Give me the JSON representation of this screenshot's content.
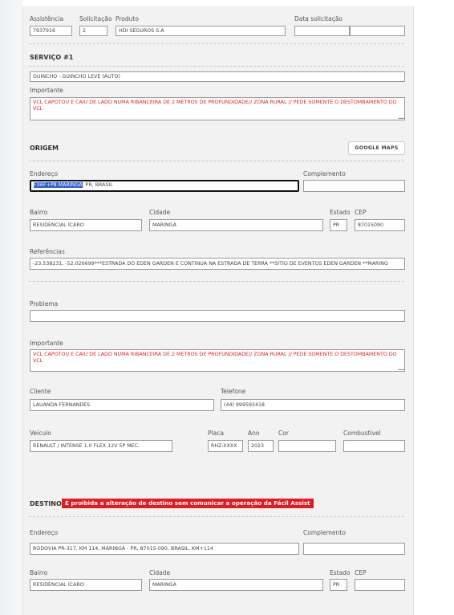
{
  "header": {
    "assistencia_label": "Assistência",
    "assistencia_value": "7937916",
    "solicitacao_label": "Solicitação",
    "solicitacao_value": "2",
    "produto_label": "Produto",
    "produto_value": "HDI SEGUROS S.A",
    "data_label": "Data solicitação",
    "data_value": "",
    "data_value2": ""
  },
  "servico": {
    "title": "SERVIÇO #1",
    "value": "GUINCHO - GUINCHO LEVE (AUTO)",
    "importante_label": "Importante",
    "importante_text": "VCL CAPOTOU E CAIU DE LADO NUMA RIBANCEIRA DE 2 METROS DE PROFUNDIDADE// ZONA RURAL // PEDE SOMENTE O DESTOMBAMENTO DO VCL"
  },
  "origem": {
    "title": "ORIGEM",
    "google_maps_label": "GOOGLE MAPS",
    "endereco_label": "Endereço",
    "endereco_selected": "FX6F+P8 MARINGÁ",
    "endereco_rest": ", PR, BRASIL",
    "complemento_label": "Complemento",
    "complemento_value": "",
    "bairro_label": "Bairro",
    "bairro_value": "RESIDENCIAL ÍCARO",
    "cidade_label": "Cidade",
    "cidade_value": "MARINGÁ",
    "estado_label": "Estado",
    "estado_value": "PR",
    "cep_label": "CEP",
    "cep_value": "87015090",
    "referencias_label": "Referências",
    "referencias_value": "-23.538231, -52.026699***ESTRADA DO EDEN GARDEN E CONTINUA NA ESTRADA DE TERRA **SITIO DE EVENTOS EDEN GARDEN **MARING",
    "problema_label": "Problema",
    "problema_value": "",
    "importante_label": "Importante",
    "importante_text": "VCL CAPOTOU E CAIU DE LADO NUMA RIBANCEIRA DE 2 METROS DE PROFUNDIDADE// ZONA RURAL // PEDE SOMENTE O DESTOMBAMENTO DO VCL",
    "cliente_label": "Cliente",
    "cliente_value": "LAUANDA FERNANDES",
    "telefone_label": "Telefone",
    "telefone_value": "(44) 999592418",
    "veiculo_label": "Veículo",
    "veiculo_value": "RENAULT / INTENSE 1.0 FLEX 12V 5P MEC.",
    "placa_label": "Placa",
    "placa_value": "RHZ-XXXX",
    "ano_label": "Ano",
    "ano_value": "2023",
    "cor_label": "Cor",
    "cor_value": "",
    "combustivel_label": "Combustível",
    "combustivel_value": ""
  },
  "destino": {
    "title": "DESTINO",
    "alert": "É proibida a alteração de destino sem comunicar a operação da Fácil Assist",
    "endereco_label": "Endereço",
    "endereco_value": "RODOVIA PR-317, KM 114, MARINGÁ - PR, 87015-090, BRASIL, KM+114",
    "complemento_label": "Complemento",
    "complemento_value": "",
    "bairro_label": "Bairro",
    "bairro_value": "RESIDENCIAL ÍCARO",
    "cidade_label": "Cidade",
    "cidade_value": "MARINGÁ",
    "estado_label": "Estado",
    "estado_value": "PR",
    "cep_label": "CEP",
    "cep_value": ""
  },
  "colors": {
    "alert_red": "#e01b22",
    "important_text": "#e02222",
    "selection_blue": "#2e5fd6"
  }
}
